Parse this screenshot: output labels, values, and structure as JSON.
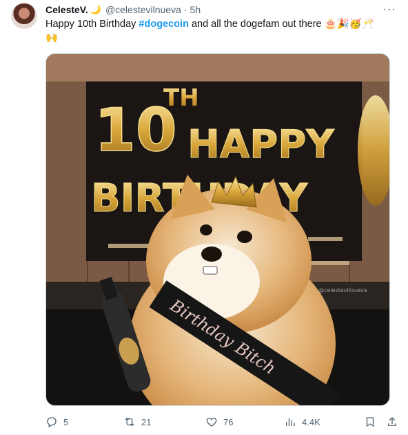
{
  "tweet": {
    "display_name": "CelesteV.",
    "name_emoji": "🌙",
    "handle": "@celestevilnueva",
    "separator": "·",
    "time": "5h",
    "more_label": "···",
    "text_before": "Happy 10th Birthday ",
    "hashtag": "#dogecoin",
    "text_after": " and all the dogefam out there 🎂🎉🥳🥂",
    "text_line2": "🙌"
  },
  "media": {
    "banner_top": "10TH HAPPY",
    "banner_bottom": "BIRTHDAY",
    "sash_text": "Birthday Bitch",
    "watermark": "@celestevilnueva"
  },
  "actions": {
    "replies": "5",
    "reposts": "21",
    "likes": "76",
    "views": "4.4K"
  },
  "icons": [
    "reply-icon",
    "repost-icon",
    "like-icon",
    "views-icon",
    "bookmark-icon",
    "share-icon",
    "more-icon"
  ]
}
